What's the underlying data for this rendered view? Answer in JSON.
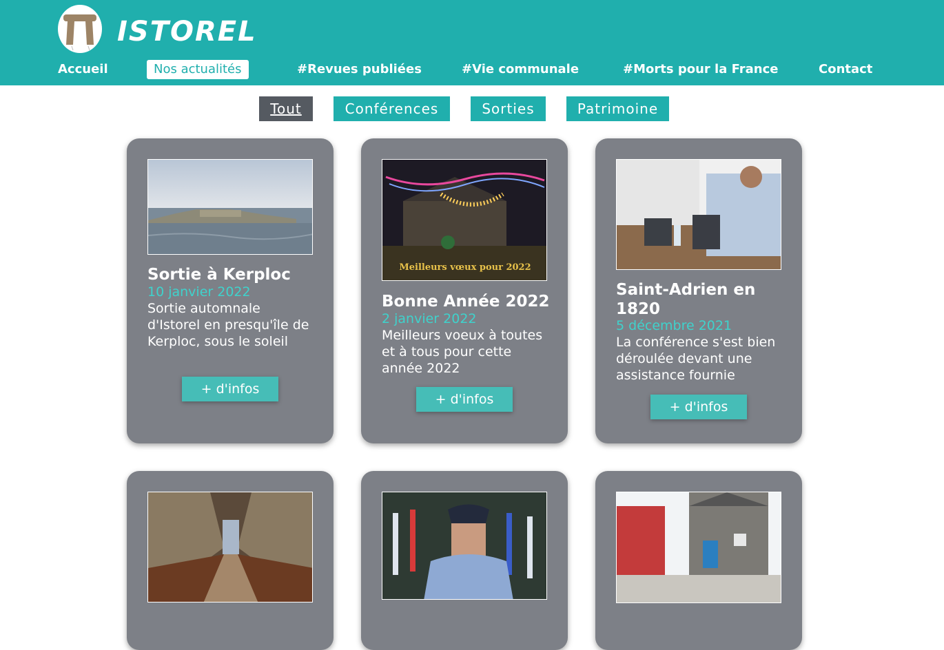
{
  "header": {
    "brand": "ISTOREL",
    "nav": [
      {
        "label": "Accueil"
      },
      {
        "label": "Nos actualités",
        "active": true
      },
      {
        "label": "#Revues publiées"
      },
      {
        "label": "#Vie communale"
      },
      {
        "label": "#Morts pour la France"
      },
      {
        "label": "Contact"
      }
    ]
  },
  "filters": [
    {
      "label": "Tout",
      "active": true
    },
    {
      "label": "Conférences"
    },
    {
      "label": "Sorties"
    },
    {
      "label": "Patrimoine"
    }
  ],
  "cards": [
    {
      "title": "Sortie à Kerploc",
      "date": "10 janvier 2022",
      "text": "Sortie automnale d'Istorel en presqu'île de Kerploc, sous le soleil",
      "button": "+ d'infos"
    },
    {
      "title": "Bonne Année 2022",
      "date": "2 janvier 2022",
      "text": "Meilleurs voeux à toutes et à tous pour cette année 2022",
      "button": "+ d'infos",
      "image_caption": "Meilleurs vœux pour 2022"
    },
    {
      "title": "Saint-Adrien en 1820",
      "date": "5 décembre 2021",
      "text": "La conférence s'est bien déroulée devant une assistance fournie",
      "button": "+ d'infos"
    },
    {},
    {},
    {}
  ],
  "colors": {
    "header_teal": "#20afad",
    "card_gray": "#7d8087",
    "date_teal": "#3fd2cc",
    "active_filter": "#555a61"
  }
}
